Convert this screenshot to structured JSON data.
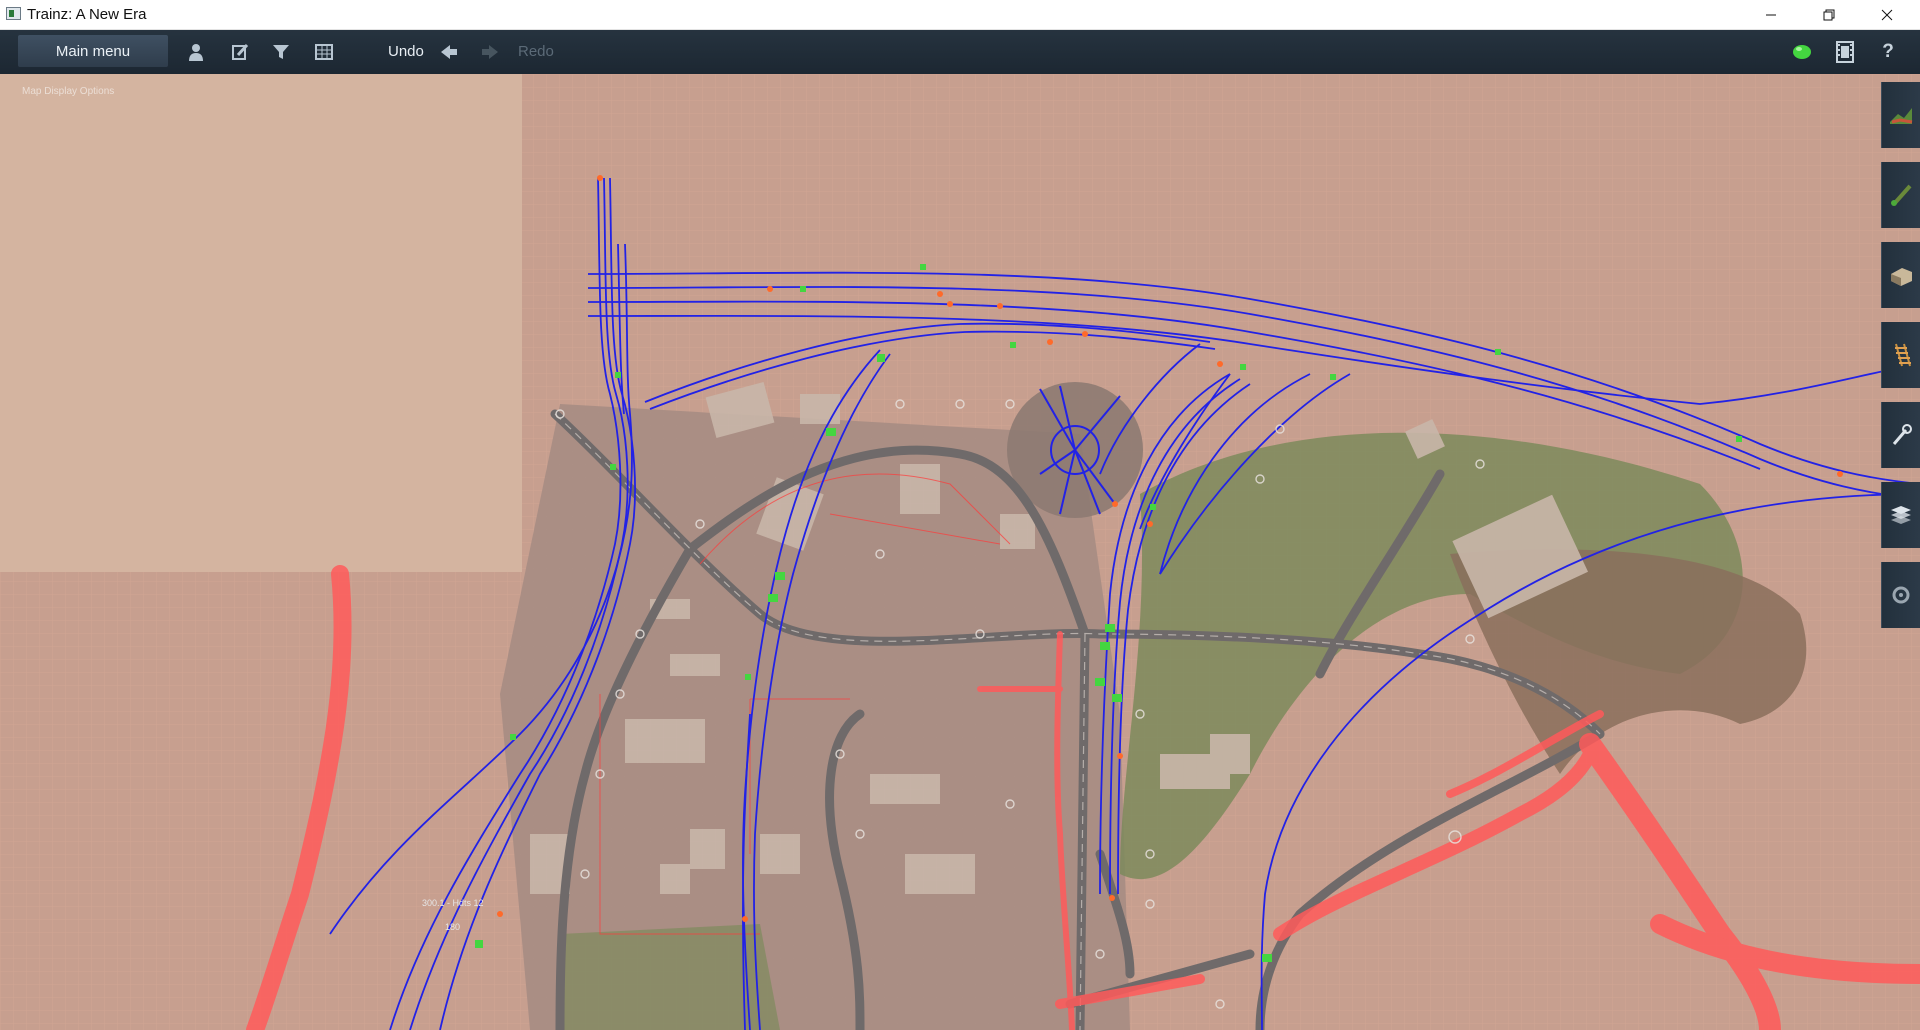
{
  "window": {
    "title": "Trainz: A New Era",
    "controls": [
      "minimize",
      "restore",
      "close"
    ]
  },
  "toolbar": {
    "main_menu_label": "Main menu",
    "undo_label": "Undo",
    "redo_label": "Redo",
    "icons": [
      "driver-icon",
      "edit-icon",
      "filter-icon",
      "grid-icon",
      "undo-arrow-icon",
      "redo-arrow-icon",
      "status-indicator-icon",
      "film-icon",
      "help-icon"
    ]
  },
  "viewport": {
    "map_display_options_label": "Map Display Options",
    "track_labels": [
      "300.1 - Hdts 12",
      "180"
    ]
  },
  "side_tools": [
    "terrain-tool-icon",
    "paint-tool-icon",
    "objects-tool-icon",
    "track-tool-icon",
    "tools-icon",
    "layers-icon",
    "settings-icon"
  ],
  "colors": {
    "toolbar_bg": "#1f2a35",
    "track_blue": "#2222e6",
    "terrain_base": "#c79f8f",
    "red_overlay": "#ff5a5a",
    "status_green": "#44d640"
  }
}
